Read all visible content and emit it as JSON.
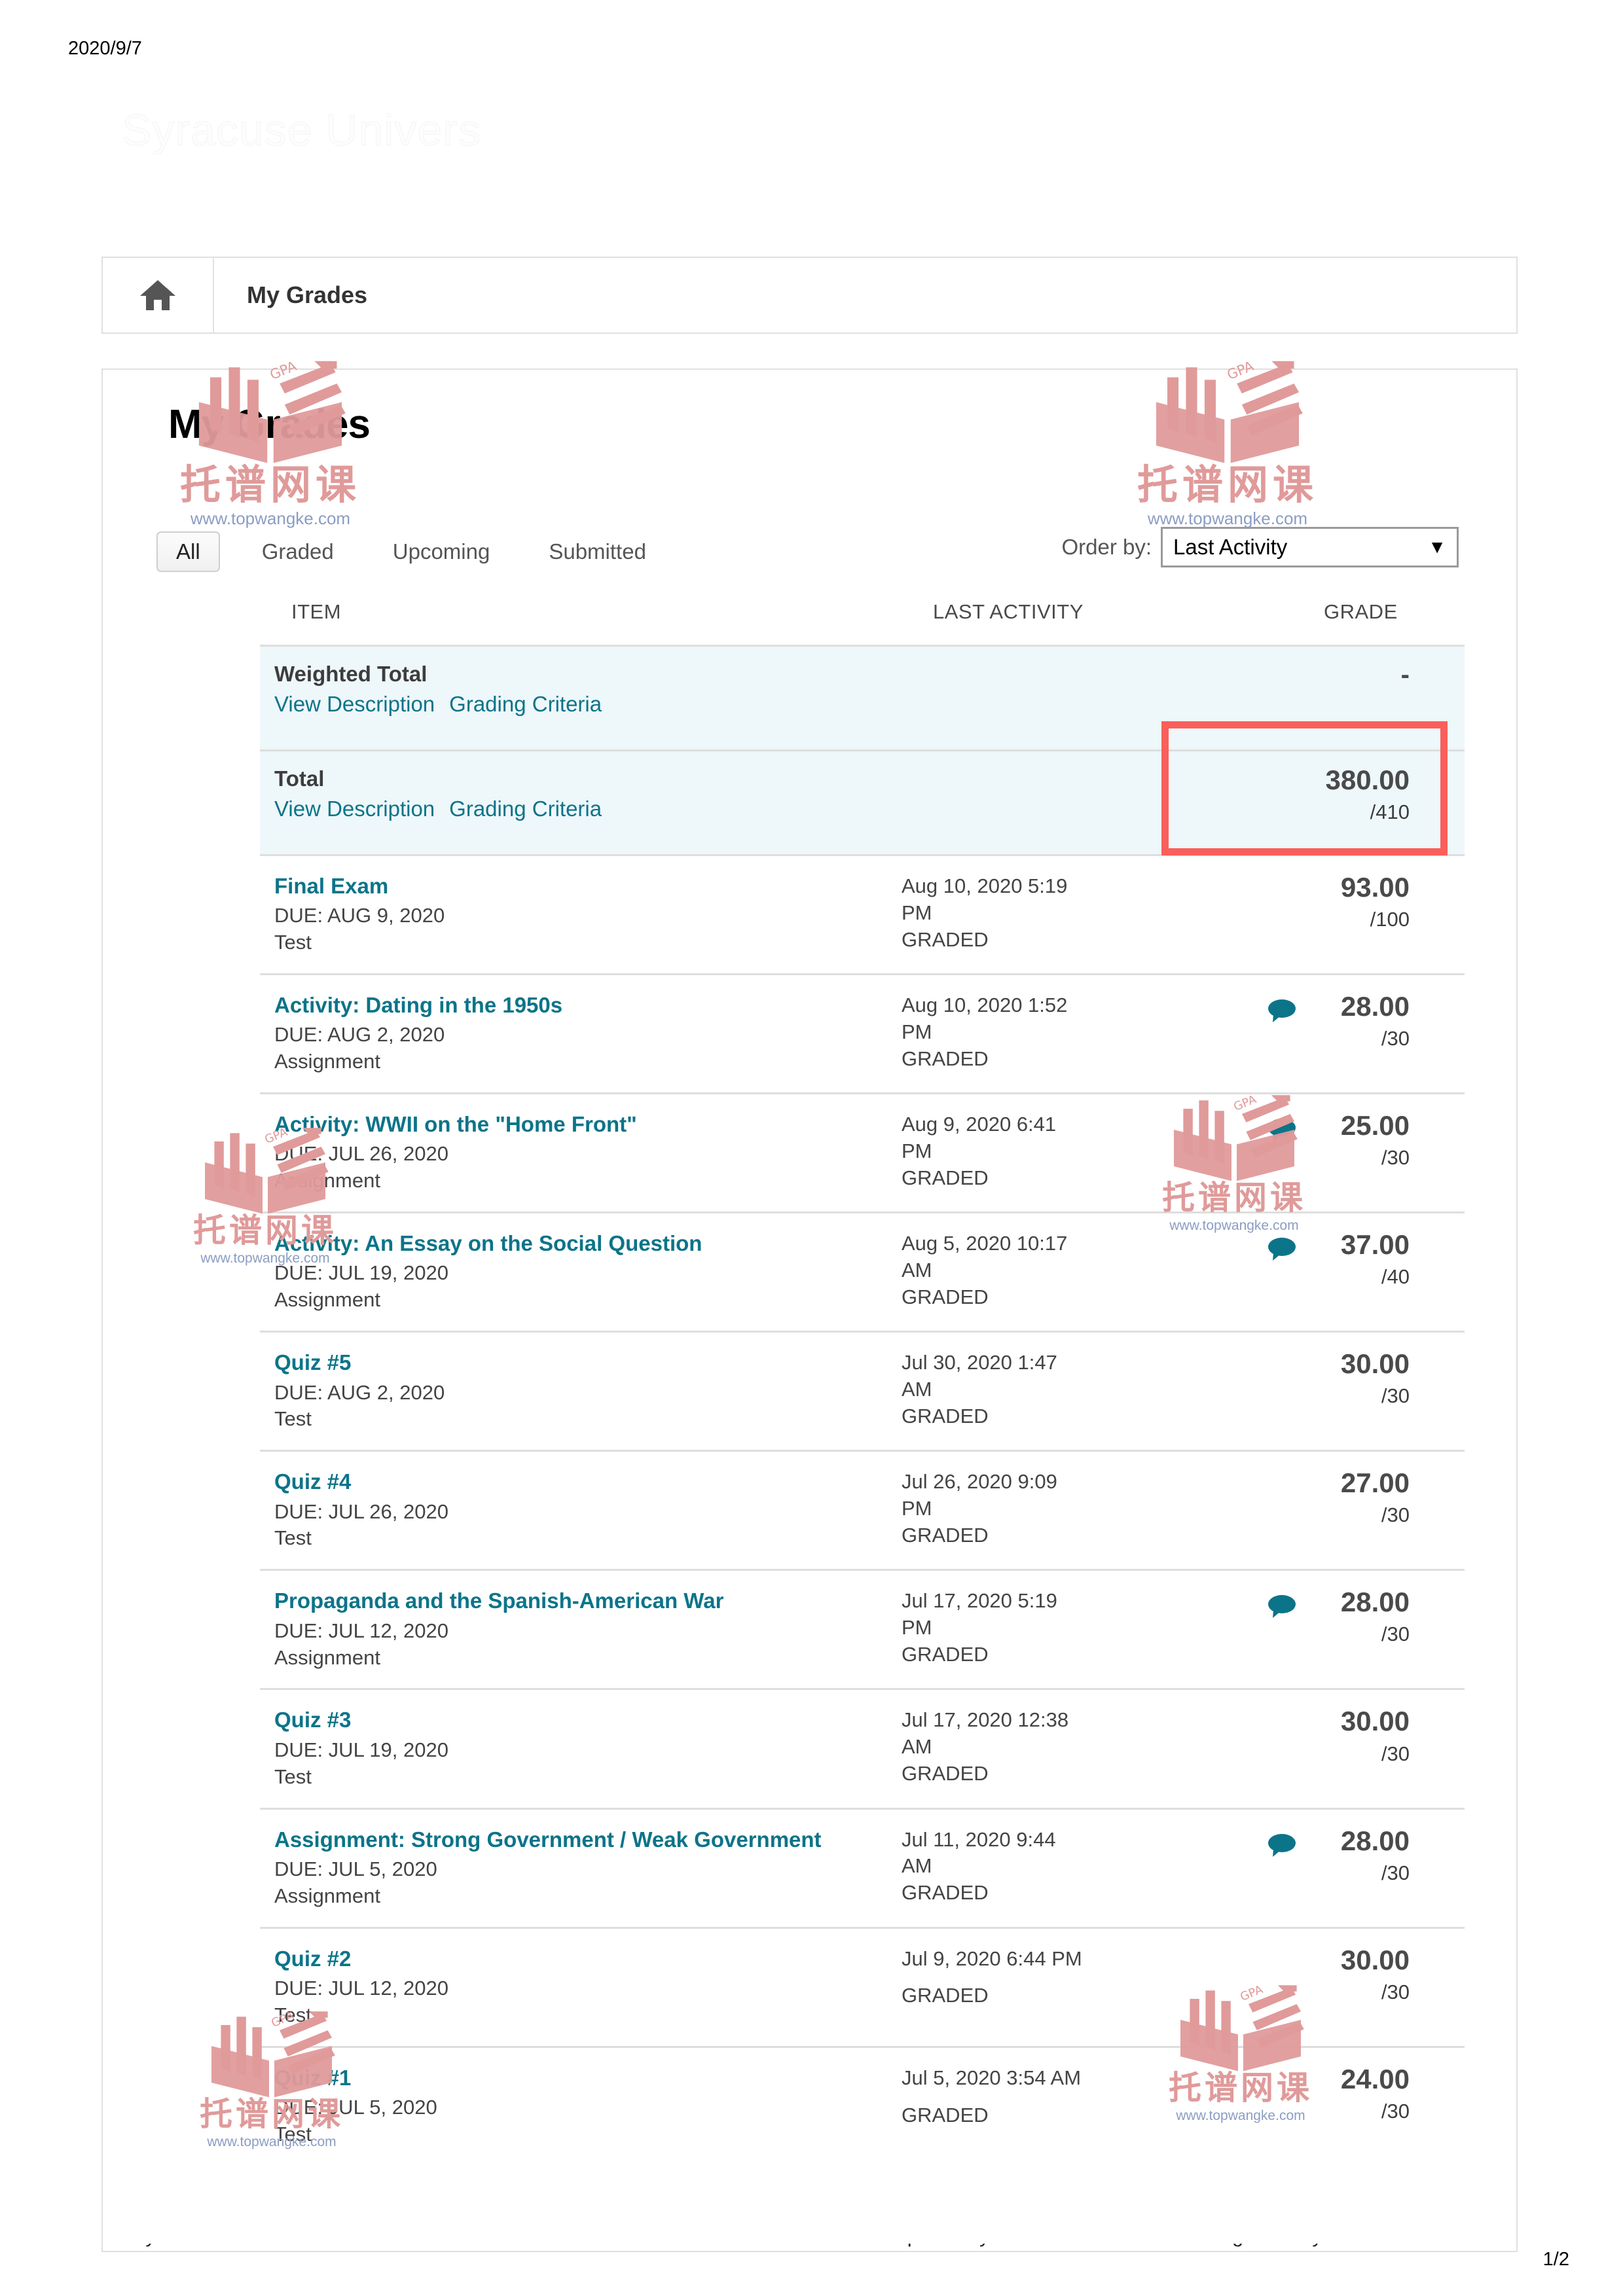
{
  "print": {
    "date": "2020/9/7",
    "page_indicator": "1/2"
  },
  "ghost_header": "Syracuse Univers",
  "navbar": {
    "home_icon": "home-icon",
    "title": "My Grades"
  },
  "page_title": "My Grades",
  "tabs": [
    {
      "label": "All",
      "active": true
    },
    {
      "label": "Graded",
      "active": false
    },
    {
      "label": "Upcoming",
      "active": false
    },
    {
      "label": "Submitted",
      "active": false
    }
  ],
  "order_by": {
    "label": "Order by:",
    "selected": "Last Activity",
    "caret": "chevron-down-icon"
  },
  "table": {
    "headers": {
      "item": "ITEM",
      "last_activity": "LAST ACTIVITY",
      "grade": "GRADE"
    },
    "rows": [
      {
        "title": "Weighted Total",
        "is_total": true,
        "links": [
          "View Description",
          "Grading Criteria"
        ],
        "activity_date": "",
        "activity_status": "",
        "grade": "-",
        "out_of": "",
        "has_comment": false
      },
      {
        "title": "Total",
        "is_total": true,
        "links": [
          "View Description",
          "Grading Criteria"
        ],
        "activity_date": "",
        "activity_status": "",
        "grade": "380.00",
        "out_of": "/410",
        "has_comment": false
      },
      {
        "title": "Final Exam",
        "is_total": false,
        "due": "DUE: AUG 9, 2020",
        "type": "Test",
        "activity_date": "Aug 10, 2020 5:19 PM",
        "activity_status": "GRADED",
        "grade": "93.00",
        "out_of": "/100",
        "has_comment": false
      },
      {
        "title": "Activity: Dating in the 1950s",
        "is_total": false,
        "due": "DUE: AUG 2, 2020",
        "type": "Assignment",
        "activity_date": "Aug 10, 2020 1:52 PM",
        "activity_status": "GRADED",
        "grade": "28.00",
        "out_of": "/30",
        "has_comment": true
      },
      {
        "title": "Activity: WWII on the \"Home Front\"",
        "is_total": false,
        "due": "DUE: JUL 26, 2020",
        "type": "Assignment",
        "activity_date": "Aug 9, 2020 6:41 PM",
        "activity_status": "GRADED",
        "grade": "25.00",
        "out_of": "/30",
        "has_comment": true
      },
      {
        "title": "Activity: An Essay on the Social Question",
        "is_total": false,
        "due": "DUE: JUL 19, 2020",
        "type": "Assignment",
        "activity_date": "Aug 5, 2020 10:17 AM",
        "activity_status": "GRADED",
        "grade": "37.00",
        "out_of": "/40",
        "has_comment": true
      },
      {
        "title": "Quiz #5",
        "is_total": false,
        "due": "DUE: AUG 2, 2020",
        "type": "Test",
        "activity_date": "Jul 30, 2020 1:47 AM",
        "activity_status": "GRADED",
        "grade": "30.00",
        "out_of": "/30",
        "has_comment": false
      },
      {
        "title": "Quiz #4",
        "is_total": false,
        "due": "DUE: JUL 26, 2020",
        "type": "Test",
        "activity_date": "Jul 26, 2020 9:09 PM",
        "activity_status": "GRADED",
        "grade": "27.00",
        "out_of": "/30",
        "has_comment": false
      },
      {
        "title": "Propaganda and the Spanish-American War",
        "is_total": false,
        "due": "DUE: JUL 12, 2020",
        "type": "Assignment",
        "activity_date": "Jul 17, 2020 5:19 PM",
        "activity_status": "GRADED",
        "grade": "28.00",
        "out_of": "/30",
        "has_comment": true
      },
      {
        "title": "Quiz #3",
        "is_total": false,
        "due": "DUE: JUL 19, 2020",
        "type": "Test",
        "activity_date": "Jul 17, 2020 12:38 AM",
        "activity_status": "GRADED",
        "grade": "30.00",
        "out_of": "/30",
        "has_comment": false
      },
      {
        "title": "Assignment: Strong Government / Weak Government",
        "is_total": false,
        "due": "DUE: JUL 5, 2020",
        "type": "Assignment",
        "activity_date": "Jul 11, 2020 9:44 AM",
        "activity_status": "GRADED",
        "grade": "28.00",
        "out_of": "/30",
        "has_comment": true
      },
      {
        "title": "Quiz #2",
        "is_total": false,
        "due": "DUE: JUL 12, 2020",
        "type": "Test",
        "activity_date": "Jul 9, 2020 6:44 PM",
        "activity_status": "GRADED",
        "grade": "30.00",
        "out_of": "/30",
        "has_comment": false,
        "single_line_date": true
      },
      {
        "title": "Quiz #1",
        "is_total": false,
        "due": "DUE: JUL 5, 2020",
        "type": "Test",
        "activity_date": "Jul 5, 2020 3:54 AM",
        "activity_status": "GRADED",
        "grade": "24.00",
        "out_of": "/30",
        "has_comment": false,
        "single_line_date": true
      }
    ]
  },
  "annotation": {
    "highlight_color": "#fa5f5b",
    "highlights": [
      "total-grade-cell"
    ]
  },
  "watermark": {
    "cn_text": "托谱网课",
    "url": "www.topwangke.com",
    "badge": "GPA",
    "color": "#e09a9a"
  },
  "colors": {
    "link_teal": "#0c7489",
    "total_row_bg": "#eef7fa",
    "grade_text": "#4a4a4a",
    "red_annotation": "#fa5f5b"
  }
}
